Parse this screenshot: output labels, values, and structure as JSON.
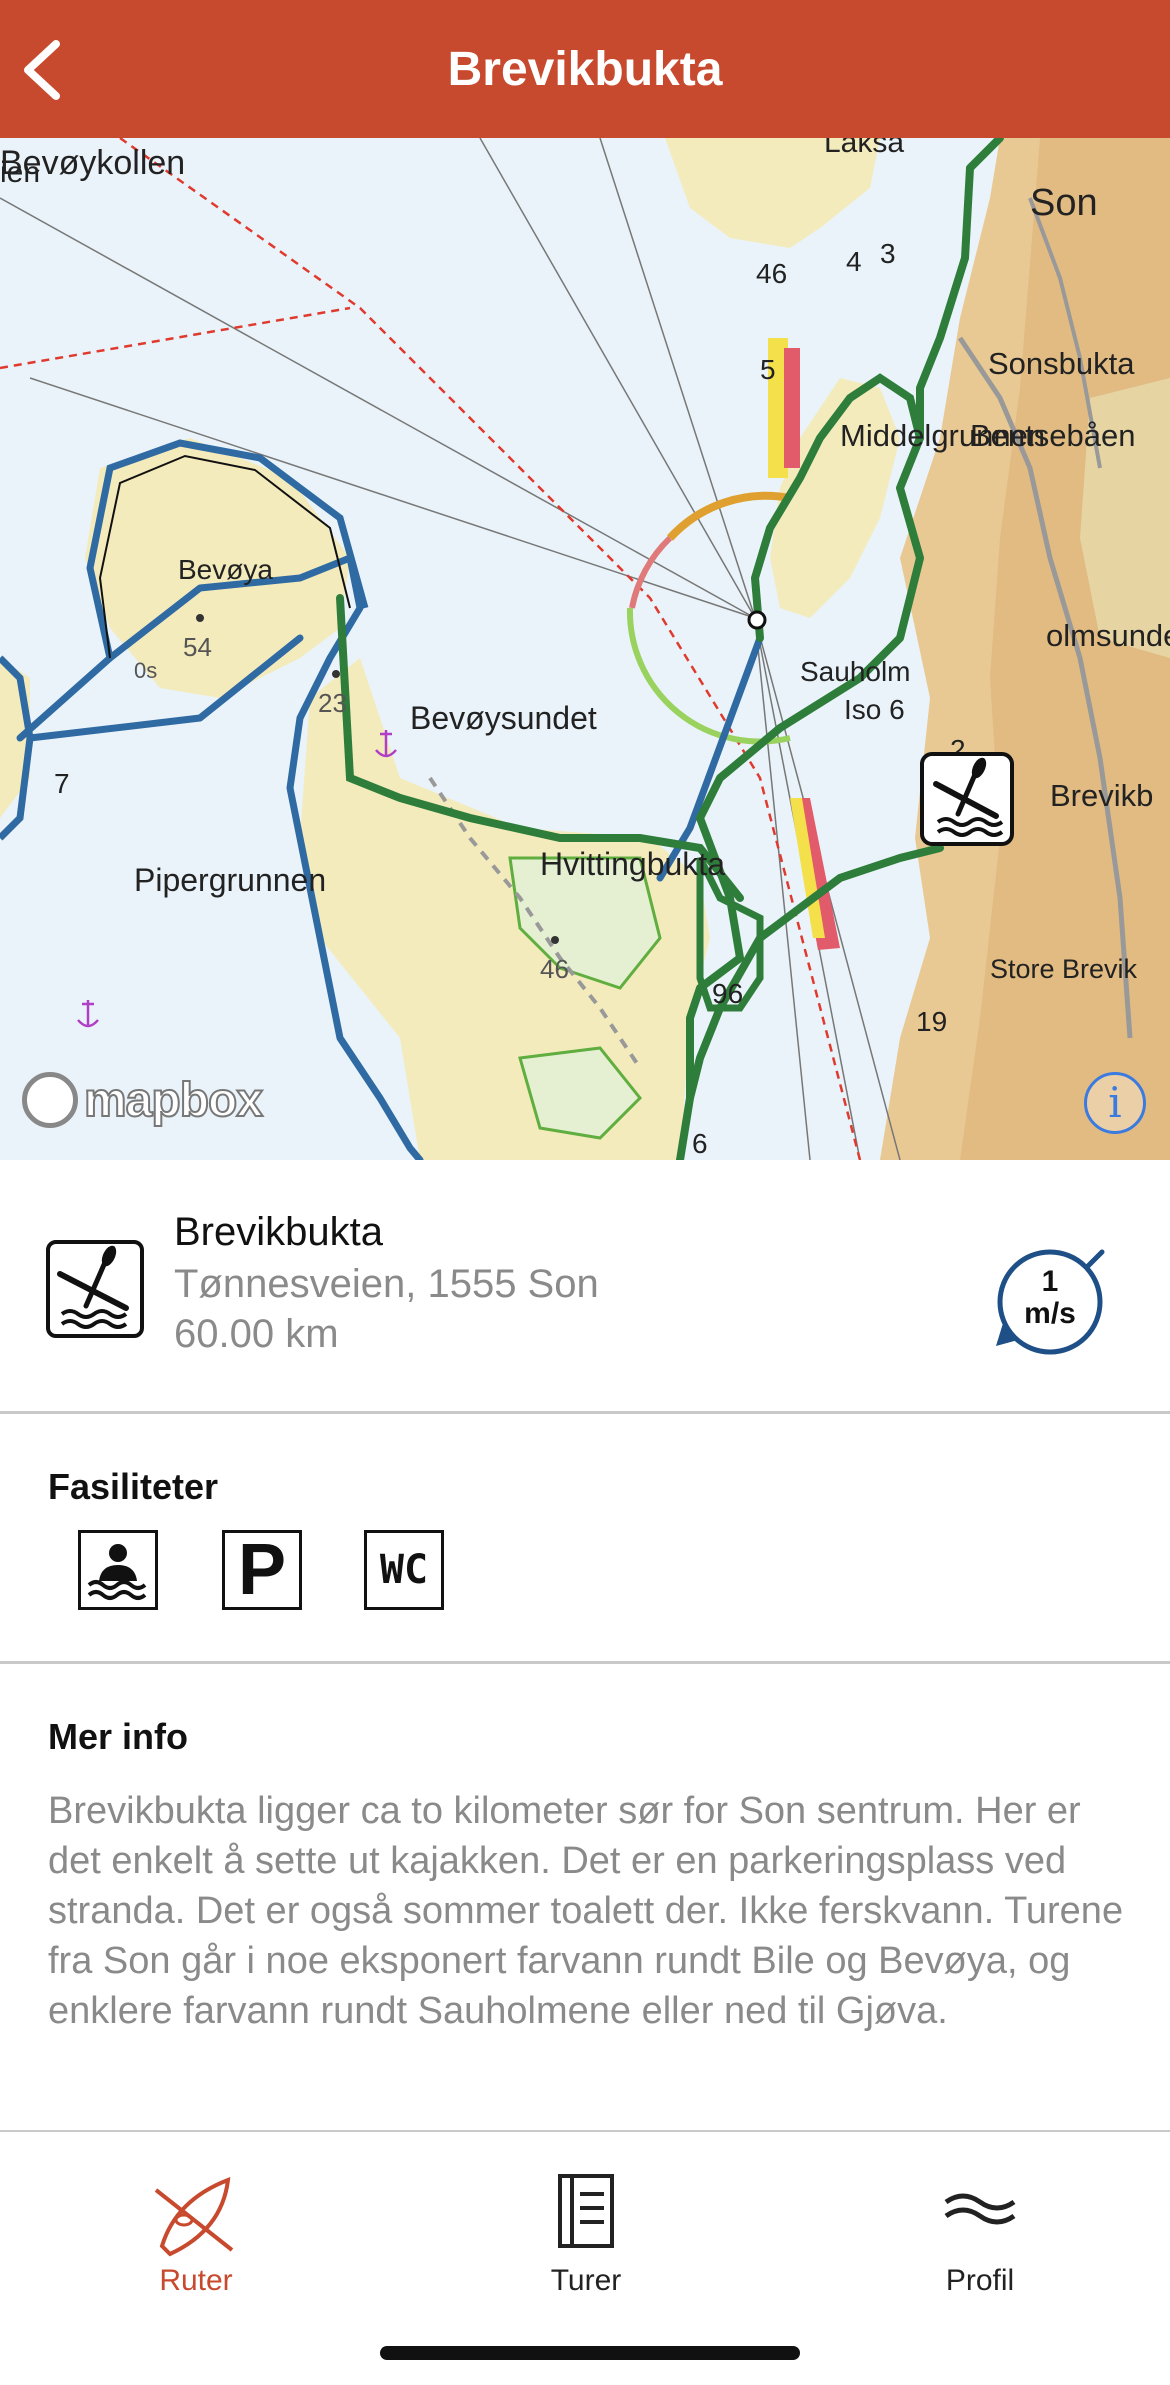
{
  "header": {
    "title": "Brevikbukta"
  },
  "map": {
    "labels": {
      "bevoykollen": "Bevøykollen",
      "ien": "ien",
      "laksa": "Laksa",
      "son": "Son",
      "sonsbukta": "Sonsbukta",
      "middelgrunnen": "Middelgrunnen",
      "bentsebaen": "Bentsebåen",
      "bevoya": "Bevøya",
      "bevoya_height": "54",
      "sauholm": "Sauholm",
      "iso": "Iso 6",
      "holmsunde": "olmsunde",
      "bevoysundet": "Bevøysundet",
      "brevik": "Brevikb",
      "pipergrunnen": "Pipergrunnen",
      "hvitting": "Hvittingbukta",
      "height_23": "23",
      "height_46": "46",
      "store_brevik": "Store Brevik",
      "depth_3a": "3",
      "depth_4": "4",
      "depth_6": "6",
      "depth_5": "5",
      "depth_7": "7",
      "depth_2": "2",
      "depth_19": "19",
      "depth_96": "96",
      "depth_46": "46",
      "depth_0s": "0s"
    },
    "attribution": "mapbox",
    "info_label": "i"
  },
  "spot": {
    "name": "Brevikbukta",
    "address": "Tønnesveien, 1555 Son",
    "distance": "60.00 km",
    "icon": "kayak-launch-icon",
    "wind": {
      "value": "1",
      "unit": "m/s"
    }
  },
  "facilities": {
    "title": "Fasiliteter",
    "items": [
      {
        "name": "swimming-icon",
        "label": ""
      },
      {
        "name": "parking-icon",
        "label": "P"
      },
      {
        "name": "toilet-icon",
        "label": "WC"
      }
    ]
  },
  "more_info": {
    "title": "Mer info",
    "text": "Brevikbukta ligger ca to kilometer sør for Son sentrum. Her er det enkelt å sette ut kajakken. Det er en parkeringsplass ved stranda. Det er også sommer toalett der. Ikke ferskvann. Turene fra Son går i noe eksponert farvann rundt Bile og Bevøya, og enklere farvann rundt Sauholmene eller ned til Gjøva."
  },
  "tabs": [
    {
      "label": "Ruter",
      "active": true,
      "icon": "kayak-icon"
    },
    {
      "label": "Turer",
      "active": false,
      "icon": "logbook-icon"
    },
    {
      "label": "Profil",
      "active": false,
      "icon": "waves-icon"
    }
  ],
  "colors": {
    "brand": "#c84a2e",
    "route_green": "#2e7d3a",
    "route_blue": "#2f6aa3",
    "secondary_text": "#8a8a8a"
  }
}
